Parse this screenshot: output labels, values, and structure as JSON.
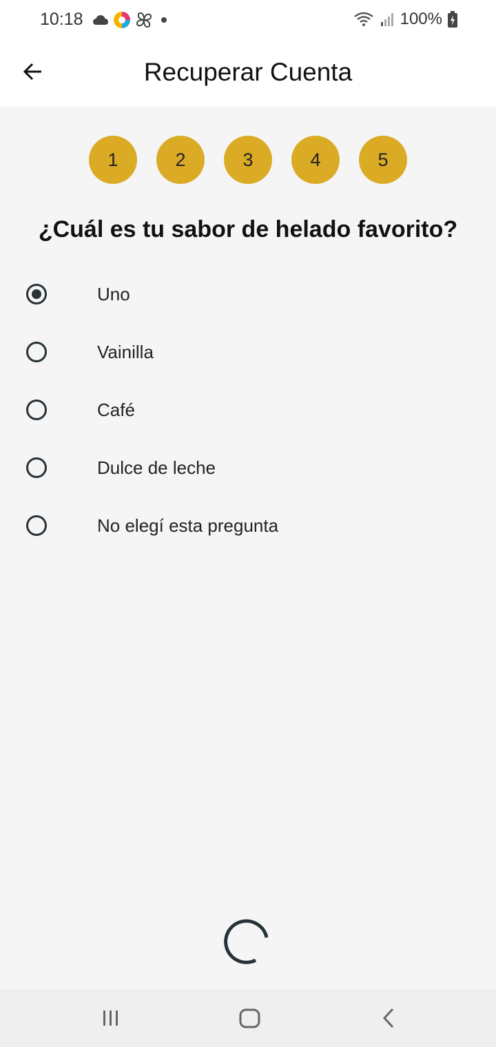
{
  "status_bar": {
    "time": "10:18",
    "battery": "100%",
    "icons": [
      "cloud-icon",
      "browser-icon",
      "pinwheel-icon",
      "dot-icon",
      "wifi-icon",
      "signal-icon",
      "battery-charging-icon"
    ]
  },
  "app_bar": {
    "title": "Recuperar Cuenta",
    "back_icon": "arrow-left-icon"
  },
  "steps": [
    "1",
    "2",
    "3",
    "4",
    "5"
  ],
  "accent_color": "#dbab25",
  "question": "¿Cuál es tu sabor de helado favorito?",
  "options": [
    {
      "label": "Uno",
      "selected": true
    },
    {
      "label": "Vainilla",
      "selected": false
    },
    {
      "label": "Café",
      "selected": false
    },
    {
      "label": "Dulce de leche",
      "selected": false
    },
    {
      "label": "No elegí esta pregunta",
      "selected": false
    }
  ],
  "loading_indicator": "spinner-icon",
  "nav_bar": {
    "items": [
      "recents-icon",
      "home-icon",
      "back-icon"
    ]
  }
}
